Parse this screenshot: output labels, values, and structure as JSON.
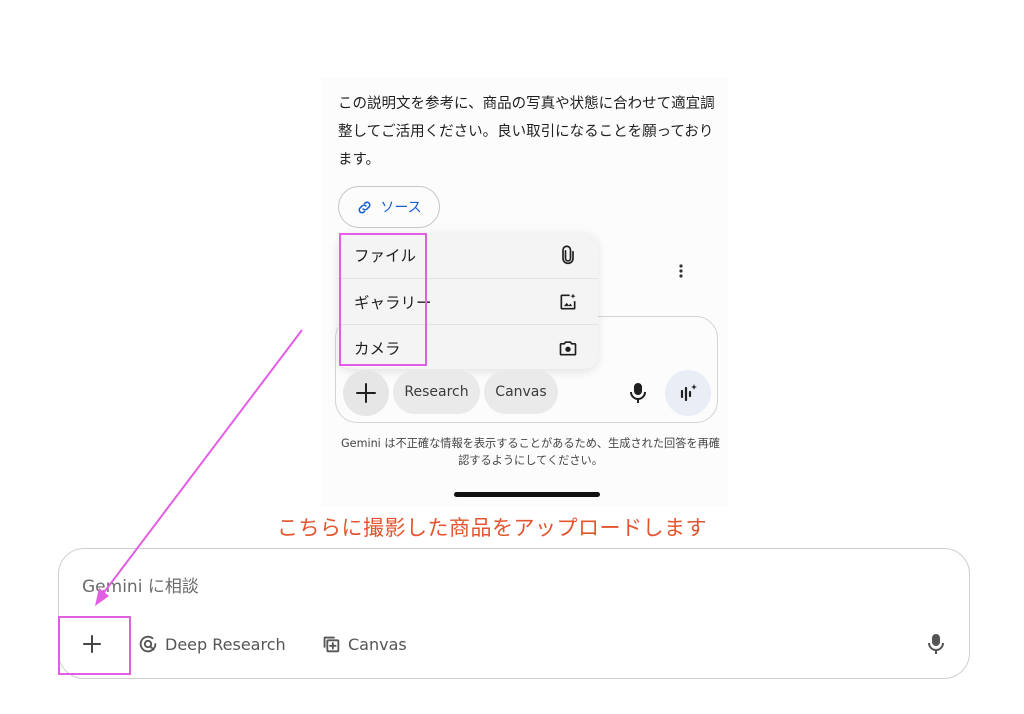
{
  "message": {
    "text": "この説明文を参考に、商品の写真や状態に合わせて適宜調整してご活用ください。良い取引になることを願っております。"
  },
  "source_chip": {
    "label": "ソース",
    "icon": "link-icon"
  },
  "attach_menu": {
    "items": [
      {
        "label": "ファイル",
        "icon": "paperclip-icon"
      },
      {
        "label": "ギャラリー",
        "icon": "gallery-icon"
      },
      {
        "label": "カメラ",
        "icon": "camera-icon"
      }
    ]
  },
  "mobile_composer": {
    "tools": [
      "Research",
      "Canvas"
    ]
  },
  "disclaimer": "Gemini は不正確な情報を表示することがあるため、生成された回答を再確認するようにしてください。",
  "annotation": {
    "caption": "こちらに撮影した商品をアップロードします",
    "caption_color": "#e4552f",
    "highlight_color": "#e25ee2"
  },
  "desktop_composer": {
    "placeholder": "Gemini に相談",
    "tools": [
      {
        "label": "Deep Research",
        "icon": "deep-research-icon"
      },
      {
        "label": "Canvas",
        "icon": "canvas-icon"
      }
    ]
  },
  "colors": {
    "link_blue": "#1a5fd0",
    "text": "#1f1f1f"
  }
}
